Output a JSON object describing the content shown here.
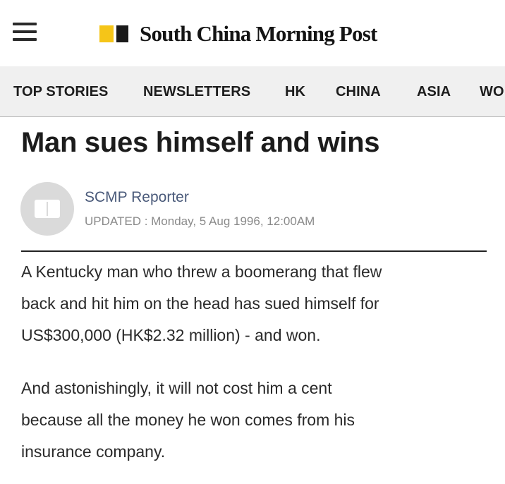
{
  "header": {
    "menu_icon": "hamburger-menu-icon",
    "logo_text": "South China Morning Post",
    "logo_colors": {
      "yellow": "#f5c518",
      "black": "#1a1a1a"
    }
  },
  "nav": {
    "items": [
      "TOP STORIES",
      "NEWSLETTERS",
      "HK",
      "CHINA",
      "ASIA",
      "WO"
    ]
  },
  "article": {
    "headline": "Man sues himself and wins",
    "author": "SCMP Reporter",
    "updated": "UPDATED : Monday, 5 Aug 1996, 12:00AM",
    "avatar_icon": "book-icon",
    "paragraphs": [
      {
        "lines": [
          "A Kentucky man who threw a boomerang that flew",
          "back and hit him on the head has sued himself for",
          "US$300,000 (HK$2.32 million) - and won."
        ]
      },
      {
        "lines": [
          "And astonishingly, it will not cost him a cent",
          "because all the money he won comes from his",
          "insurance company."
        ]
      }
    ]
  }
}
